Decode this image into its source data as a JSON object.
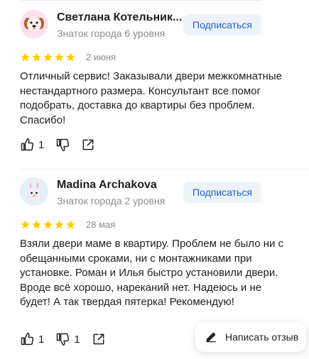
{
  "reviews": [
    {
      "author": "Светлана Котельник...",
      "level": "Знаток города 6 уровня",
      "subscribe_label": "Подписаться",
      "rating": 5,
      "date": "2 июня",
      "text": "Отличный сервис! Заказывали двери межкомнатные нестандартного размера. Консультант все помог подобрать, доставка до квартиры без проблем. Спасибо!",
      "likes": "1",
      "dislikes": "",
      "avatar_icon": "dog-emoji-icon"
    },
    {
      "author": "Madina Archakova",
      "level": "Знаток города 2 уровня",
      "subscribe_label": "Подписаться",
      "rating": 5,
      "date": "28 мая",
      "text": "Взяли двери маме в квартиру. Проблем не было ни с обещанными сроками, ни с монтажниками при установке. Роман и Илья быстро установили двери. Вроде всё хорошо, нареканий нет. Надеюсь и не будет! А так твердая пятерка! Рекомендую!",
      "likes": "1",
      "dislikes": "1",
      "avatar_icon": "rabbit-emoji-icon"
    }
  ],
  "write_review_label": "Написать отзыв",
  "colors": {
    "star": "#fc0",
    "subscribe_bg": "#eef3fb",
    "subscribe_text": "#1f5fd6",
    "muted": "#8c8c8c"
  }
}
